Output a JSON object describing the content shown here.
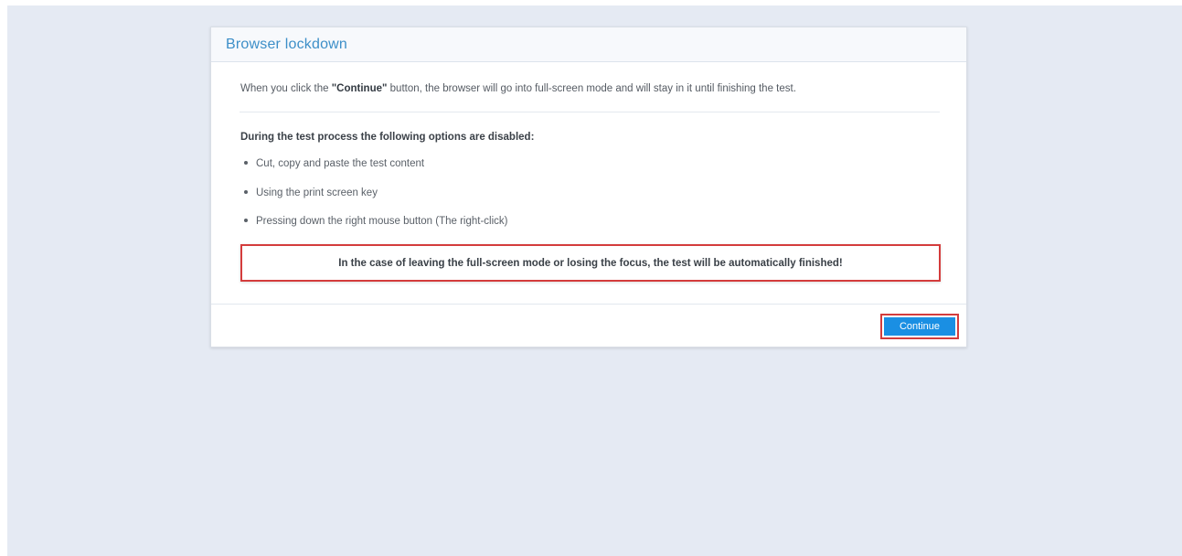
{
  "dialog": {
    "title": "Browser lockdown",
    "intro_prefix": "When you click the ",
    "intro_bold": "\"Continue\"",
    "intro_suffix": " button, the browser will go into full-screen mode and will stay in it until finishing the test.",
    "list_heading": "During the test process the following options are disabled:",
    "disabled_options": [
      "Cut, copy and paste the test content",
      "Using the print screen key",
      "Pressing down the right mouse button (The right-click)"
    ],
    "warning": "In the case of leaving the full-screen mode or losing the focus, the test will be automatically finished!",
    "continue_label": "Continue"
  },
  "colors": {
    "page_background": "#e5eaf3",
    "title": "#3d8fc8",
    "button": "#1a8fe3",
    "highlight_border": "#d43c3c"
  }
}
